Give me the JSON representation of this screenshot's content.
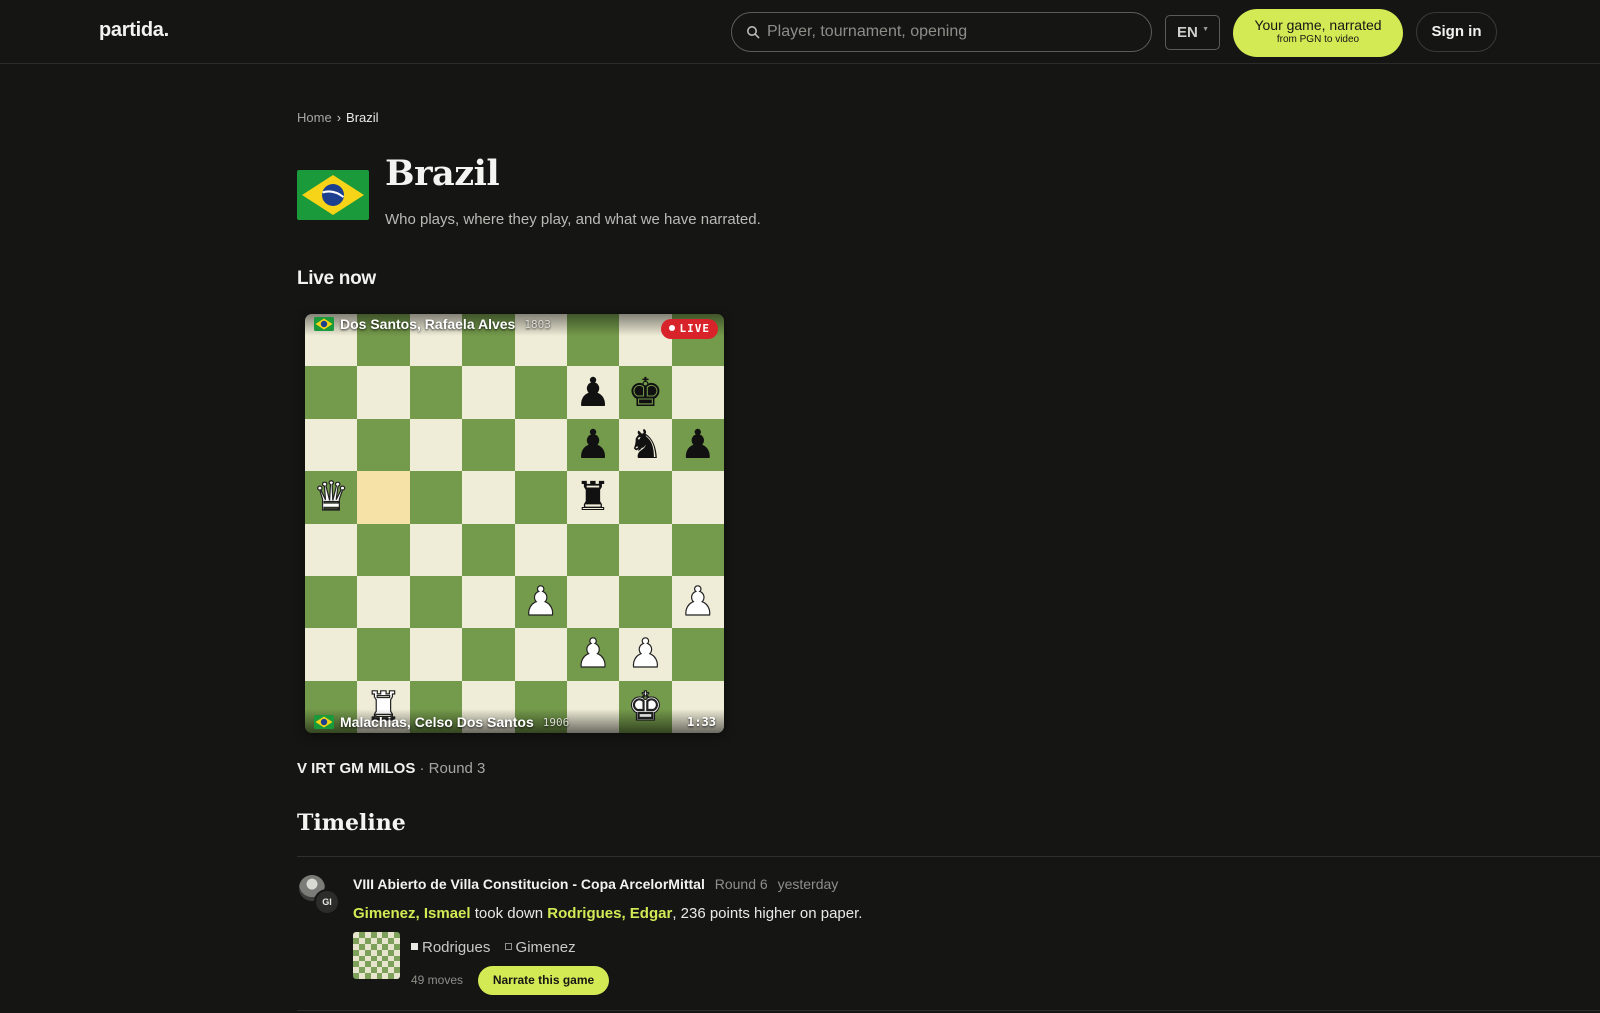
{
  "brand": {
    "logo": "partida."
  },
  "header": {
    "search_placeholder": "Player, tournament, opening",
    "lang": "EN",
    "cta_main": "Your game, narrated",
    "cta_sub": "from PGN to video",
    "signin": "Sign in"
  },
  "breadcrumb": {
    "home": "Home",
    "separator": "›",
    "current": "Brazil"
  },
  "page": {
    "title": "Brazil",
    "subtitle": "Who plays, where they play, and what we have narrated."
  },
  "live": {
    "heading": "Live now",
    "badge": "LIVE",
    "clock": "1:33",
    "top_player": {
      "name": "Dos Santos, Rafaela Alves",
      "rating": "1803"
    },
    "bottom_player": {
      "name": "Malachias, Celso Dos Santos",
      "rating": "1906"
    },
    "board": [
      "........",
      ".....pk.",
      ".....pnp",
      "Q....r..",
      "........",
      "....P..P",
      ".....PP.",
      ".R....K."
    ],
    "highlight_squares": [
      "b5"
    ],
    "event": "V IRT GM MILOS",
    "round": "· Round 3"
  },
  "timeline": {
    "heading": "Timeline",
    "items": [
      {
        "avatar_initials": "GI",
        "event": "VIII Abierto de Villa Constitucion - Copa ArcelorMittal",
        "round": "Round 6",
        "when": "yesterday",
        "winner": "Gimenez, Ismael",
        "verb": " took down ",
        "loser": "Rodrigues, Edgar",
        "rest": ", 236 points higher on paper.",
        "black_player": "Rodrigues",
        "white_player": "Gimenez",
        "moves": "49 moves",
        "action": "Narrate this game"
      }
    ]
  },
  "colors": {
    "background": "#151614",
    "accent": "#d4ea55",
    "board_light": "#efecd7",
    "board_dark": "#749a4b",
    "live_red": "#d8232a"
  }
}
